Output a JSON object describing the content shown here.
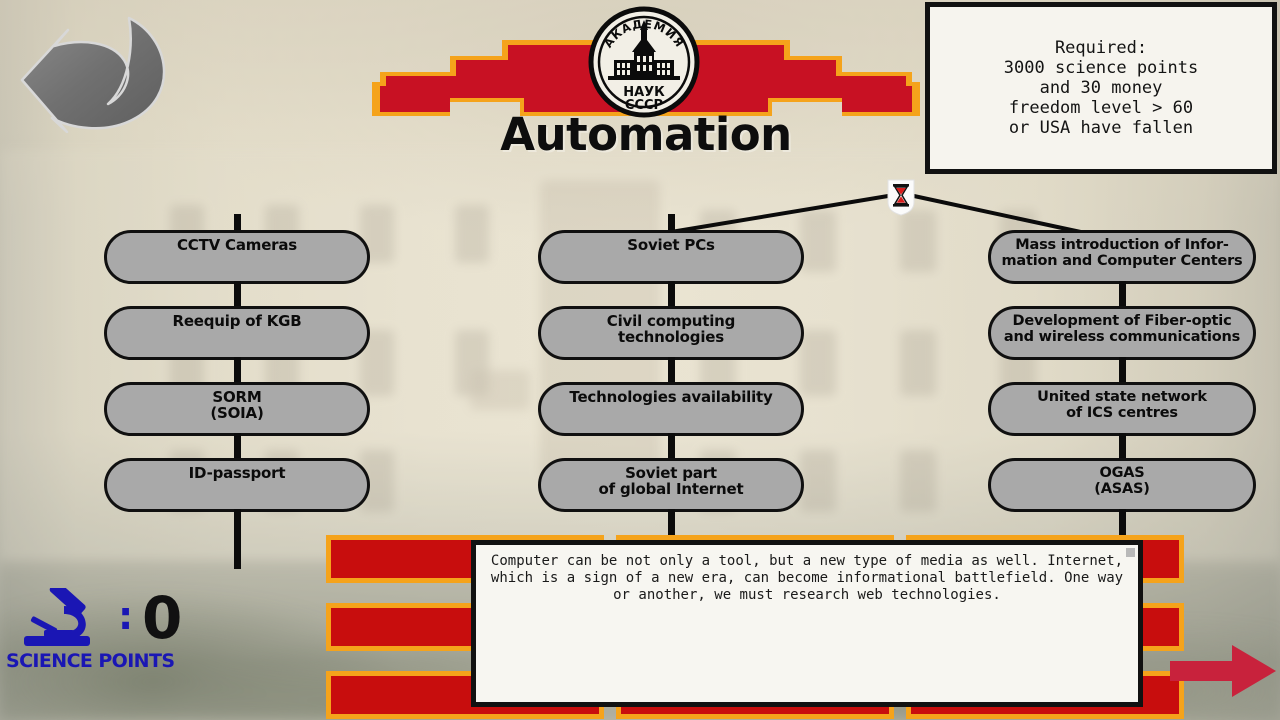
{
  "window": {
    "background_top_color": "#e6e0ce",
    "background_bottom_color": "#8f9486"
  },
  "header": {
    "title": "Automation",
    "crest_icon": "academy-of-sciences-ussr-emblem",
    "crest_top_text": "АКАДЕМИЯ",
    "crest_bottom_line1": "НАУК",
    "crest_bottom_line2": "СССР",
    "banner_red": "#c81123",
    "banner_orange": "#f5a31b"
  },
  "back_button": {
    "icon": "back-arrow-icon",
    "label": ""
  },
  "requirements": {
    "text": "Required:\n3000 science points\nand 30 money\nfreedom level > 60\nor USA have fallen"
  },
  "hourglass": {
    "icon": "hourglass-icon",
    "tooltip": ""
  },
  "tech_tree": {
    "columns": [
      {
        "id": "surveillance",
        "nodes": [
          {
            "label": "CCTV Cameras"
          },
          {
            "label": "Reequip of KGB"
          },
          {
            "label": "SORM\n(SOIA)"
          },
          {
            "label": "ID-passport"
          }
        ]
      },
      {
        "id": "computing",
        "nodes": [
          {
            "label": "Soviet PCs"
          },
          {
            "label": "Civil computing\ntechnologies"
          },
          {
            "label": "Technologies availability"
          },
          {
            "label": "Soviet part\nof global Internet"
          }
        ]
      },
      {
        "id": "infrastructure",
        "nodes": [
          {
            "label": "Mass introduction of Infor-\nmation and Computer Centers"
          },
          {
            "label": "Development of Fiber-optic\nand wireless communications"
          },
          {
            "label": "United state network\nof ICS centres"
          },
          {
            "label": "OGAS\n(ASAS)"
          }
        ]
      }
    ],
    "node_fill_color": "#a9a9a9",
    "node_border_color": "#101010"
  },
  "description": {
    "text": "Computer can be not only a tool, but a new type of media as well. Internet, which is a sign of a new era, can become informational battlefield. One way or another, we must research web technologies."
  },
  "science_points": {
    "icon": "microscope-icon",
    "separator": ":",
    "value": "0",
    "label": "SCIENCE POINTS",
    "color": "#1a16b4"
  },
  "next_button": {
    "icon": "right-arrow-icon",
    "color": "#c8223c"
  }
}
